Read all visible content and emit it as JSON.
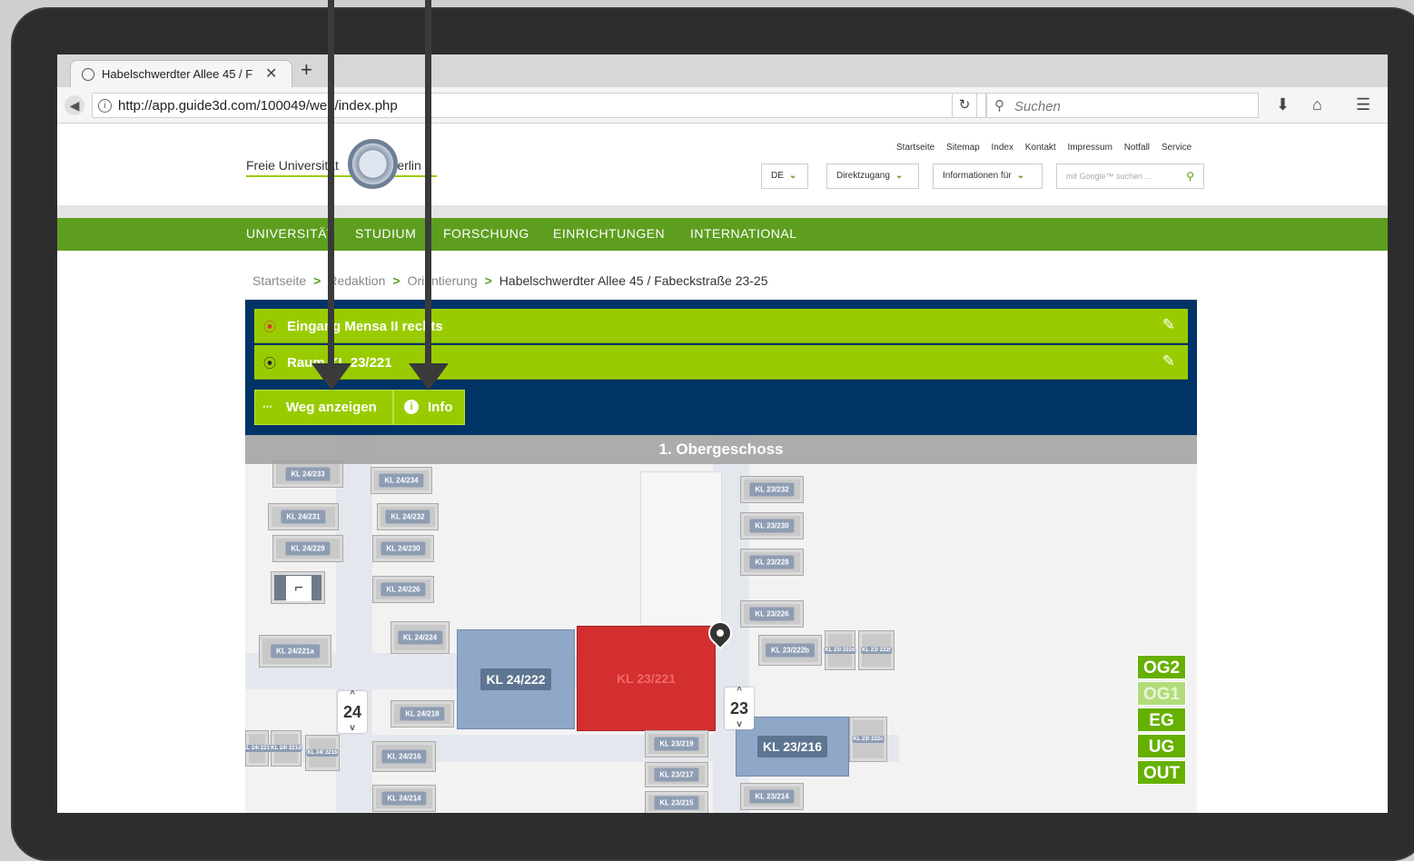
{
  "browser": {
    "tab_title": "Habelschwerdter Allee 45 / F",
    "tab_close": "✕",
    "new_tab": "+",
    "url": "http://app.guide3d.com/100049/web/index.php",
    "search_placeholder": "Suchen"
  },
  "site": {
    "logo_text_left": "Freie Universität",
    "logo_text_right": "Berlin",
    "top_links": [
      "Startseite",
      "Sitemap",
      "Index",
      "Kontakt",
      "Impressum",
      "Notfall",
      "Service"
    ],
    "lang_select": "DE",
    "direct_select": "Direktzugang",
    "info_select": "Informationen für",
    "google_placeholder": "mit Google™ suchen ..."
  },
  "main_nav": [
    "UNIVERSITÄT",
    "STUDIUM",
    "FORSCHUNG",
    "EINRICHTUNGEN",
    "INTERNATIONAL"
  ],
  "breadcrumb": {
    "items": [
      "Startseite",
      "Redaktion",
      "Orientierung"
    ],
    "current": "Habelschwerdter Allee 45 / Fabeckstraße 23-25"
  },
  "guide": {
    "start": "Eingang Mensa II rechts",
    "destination": "Raum KL 23/221",
    "route_button": "Weg anzeigen",
    "info_button": "Info",
    "floor_title": "1. Obergeschoss"
  },
  "map": {
    "rooms_left": [
      "KL 24/233",
      "KL 24/234",
      "KL 24/231",
      "KL 24/232",
      "KL 24/229",
      "KL 24/230",
      "KL 24/226",
      "KL 24/224",
      "KL 24/221a",
      "KL 24/218",
      "KL 24/216",
      "KL 24/214",
      "KL 24/ 221f",
      "KL 24/ 221d",
      "KL 24/ 221b"
    ],
    "rooms_right": [
      "KL 23/232",
      "KL 23/230",
      "KL 23/228",
      "KL 23/226",
      "KL 23/222b",
      "KL 23/ 222d",
      "KL 23/ 222f",
      "KL 23/219",
      "KL 23/217",
      "KL 23/215",
      "KL 23/214",
      "KL 23/ 222c"
    ],
    "room_24_222": "KL 24/222",
    "room_23_221": "KL 23/221",
    "room_23_216": "KL 23/216",
    "building_24": "24",
    "building_23": "23",
    "floors": [
      "OG2",
      "OG1",
      "EG",
      "UG",
      "OUT"
    ],
    "active_floor": "OG1",
    "colors": {
      "target_room": "#d32f2f",
      "highlight_rooms": "#8fa8c8",
      "floor_buttons": "#66b000"
    }
  }
}
